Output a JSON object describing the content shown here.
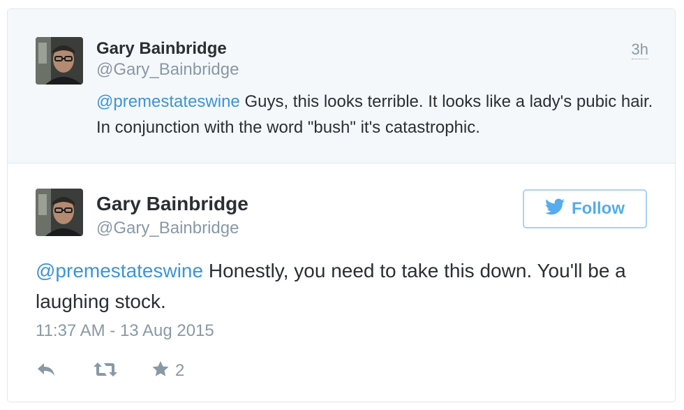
{
  "parent_tweet": {
    "author_name": "Gary Bainbridge",
    "author_handle": "@Gary_Bainbridge",
    "time_ago": "3h",
    "mention": "@premestateswine",
    "text": " Guys, this looks terrible. It looks like a lady's pubic hair. In conjunction with the word \"bush\" it's catastrophic."
  },
  "main_tweet": {
    "author_name": "Gary Bainbridge",
    "author_handle": "@Gary_Bainbridge",
    "follow_label": "Follow",
    "mention": "@premestateswine",
    "text": " Honestly, you need to take this down. You'll be a laughing stock.",
    "timestamp": "11:37 AM - 13 Aug 2015",
    "favorite_count": "2"
  },
  "icons": [
    "twitter-bird-icon",
    "reply-icon",
    "retweet-icon",
    "star-icon"
  ],
  "colors": {
    "link": "#3b94d9",
    "follow_blue": "#55acee",
    "muted": "#8899a6",
    "parent_bg": "#f5f8fa"
  }
}
